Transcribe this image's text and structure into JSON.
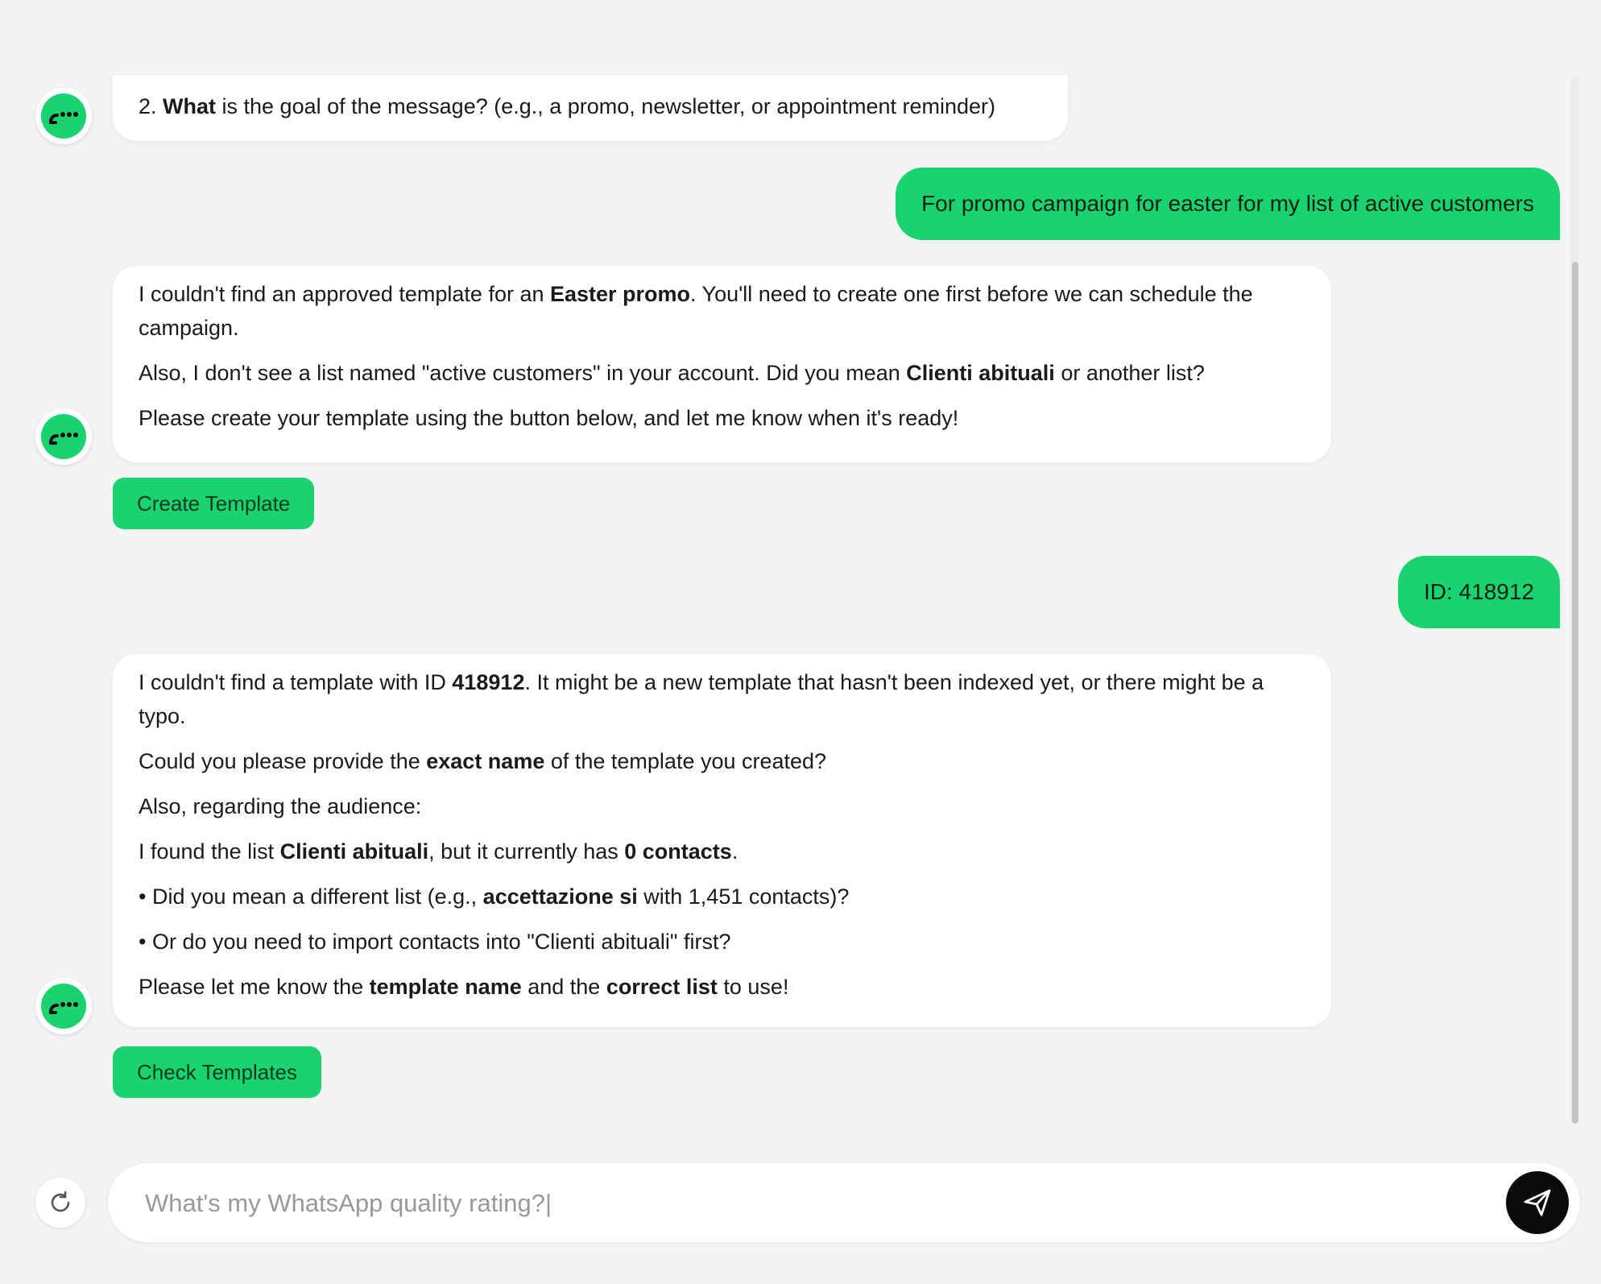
{
  "messages": {
    "bot1": {
      "line1_prefix": "2. ",
      "line1_bold": "What",
      "line1_suffix": " is the goal of the message? (e.g., a promo, newsletter, or appointment reminder)"
    },
    "user1": {
      "text": "For promo campaign for easter for my list of active customers"
    },
    "bot2": {
      "p1_prefix": "I couldn't find an approved template for an ",
      "p1_bold": "Easter promo",
      "p1_suffix": ". You'll need to create one first before we can schedule the campaign.",
      "p2_prefix": "Also, I don't see a list named \"active customers\" in your account. Did you mean ",
      "p2_bold": "Clienti abituali",
      "p2_suffix": " or another list?",
      "p3": "Please create your template using the button below, and let me know when it's ready!",
      "button_label": "Create Template"
    },
    "user2": {
      "text": "ID: 418912"
    },
    "bot3": {
      "p1_prefix": "I couldn't find a template with ID ",
      "p1_bold": "418912",
      "p1_suffix": ". It might be a new template that hasn't been indexed yet, or there might be a typo.",
      "p2_prefix": "Could you please provide the ",
      "p2_bold": "exact name",
      "p2_suffix": " of the template you created?",
      "p3": "Also, regarding the audience:",
      "p4_prefix": "I found the list ",
      "p4_bold1": "Clienti abituali",
      "p4_mid": ", but it currently has ",
      "p4_bold2": "0 contacts",
      "p4_suffix": ".",
      "p5_prefix": "• Did you mean a different list (e.g., ",
      "p5_bold": "accettazione si",
      "p5_suffix": " with 1,451 contacts)?",
      "p6": "• Or do you need to import contacts into \"Clienti abituali\" first?",
      "p7_prefix": "Please let me know the ",
      "p7_bold1": "template name",
      "p7_mid": " and the ",
      "p7_bold2": "correct list",
      "p7_suffix": " to use!",
      "button_label": "Check Templates"
    }
  },
  "composer": {
    "placeholder": "What's my WhatsApp quality rating?|",
    "refresh_icon": "refresh-icon",
    "send_icon": "send-icon"
  },
  "colors": {
    "accent": "#19d36e",
    "background": "#f4f4f4",
    "bubble": "#ffffff",
    "send_button": "#0a0a0a"
  }
}
